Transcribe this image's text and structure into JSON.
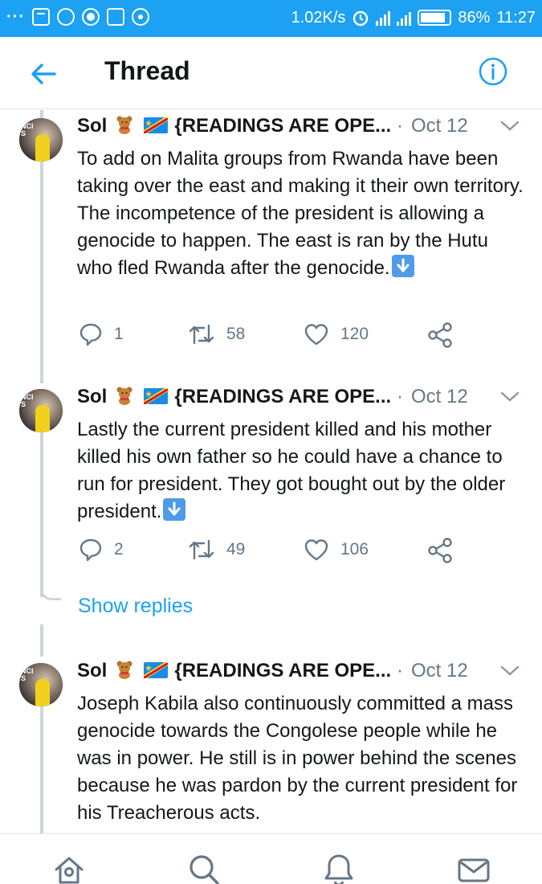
{
  "status_bar": {
    "speed": "1.02K/s",
    "battery": "86%",
    "battery_level": 0.86,
    "time": "11:27",
    "icons": [
      "more-dots-icon",
      "mail-icon",
      "chat-icon",
      "vpn-icon",
      "screenshot-icon",
      "sync-icon",
      "alarm-icon",
      "signal-4g-icon",
      "signal-icon",
      "battery-icon"
    ]
  },
  "header": {
    "title": "Thread",
    "back_icon": "arrow-left-icon",
    "info_icon": "info-icon"
  },
  "tweets": [
    {
      "name": "Sol",
      "handle_tail": "{READINGS ARE OPE...",
      "dot": "·",
      "date": "Oct 12",
      "text": "To add on Malita groups from Rwanda have been taking over the east and making it their own territory. The incompetence of the president is allowing a genocide to happen. The east is ran by the Hutu who fled Rwanda after the genocide.",
      "replies": "1",
      "retweets": "58",
      "likes": "120"
    },
    {
      "name": "Sol",
      "handle_tail": "{READINGS ARE OPE...",
      "dot": "·",
      "date": "Oct 12",
      "text": "Lastly the current president killed and his mother killed his own father so he could have a chance to run for president. They got bought out by the older president.",
      "replies": "2",
      "retweets": "49",
      "likes": "106"
    },
    {
      "name": "Sol",
      "handle_tail": "{READINGS ARE OPE...",
      "dot": "·",
      "date": "Oct 12",
      "text": "Joseph Kabila also continuously committed a mass genocide towards the Congolese people while he was in power. He still is in power behind the scenes because he was pardon by the current president for his Treacherous acts."
    }
  ],
  "show_replies": "Show replies",
  "bottom_nav": [
    "home-icon",
    "search-icon",
    "notifications-icon",
    "messages-icon"
  ],
  "colors": {
    "accent": "#1da1f2",
    "muted": "#657786",
    "text": "#14171a",
    "thread_line": "#ccd6dd"
  }
}
